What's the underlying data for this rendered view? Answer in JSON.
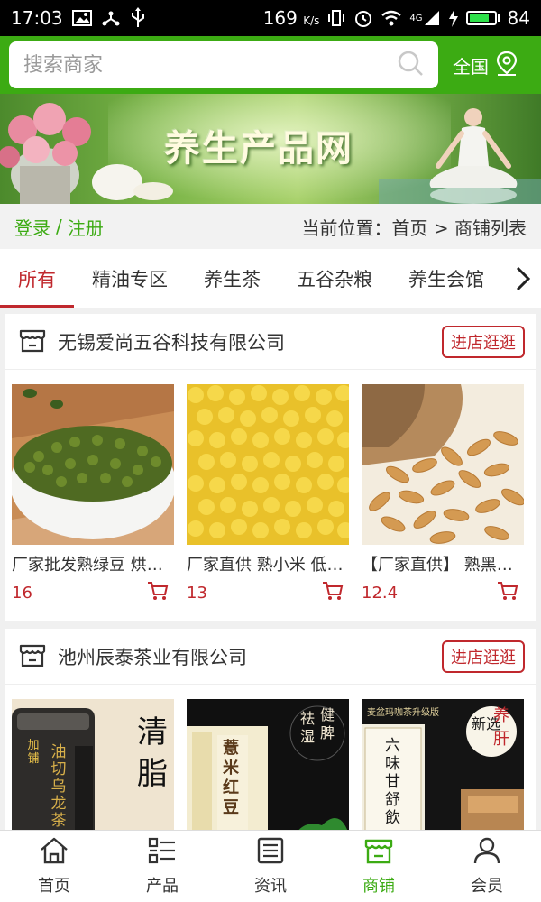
{
  "status_bar": {
    "time": "17:03",
    "speed": "169",
    "speed_unit": "K/s",
    "network": "4G",
    "battery": "84",
    "battery_level": 0.84
  },
  "search": {
    "placeholder": "搜索商家",
    "region": "全国"
  },
  "banner": {
    "title": "养生产品网"
  },
  "nav": {
    "login": "登录",
    "separator": "/",
    "register": "注册",
    "location": "当前位置：首页 > 商铺列表"
  },
  "tabs": [
    "所有",
    "精油专区",
    "养生茶",
    "五谷杂粮",
    "养生会馆"
  ],
  "shops": [
    {
      "name": "无锡爱尚五谷科技有限公司",
      "enter": "进店逛逛",
      "products": [
        {
          "name": "厂家批发熟绿豆 烘焙用绿豆",
          "price": "16"
        },
        {
          "name": "厂家直供 熟小米 低温烘焙",
          "price": "13"
        },
        {
          "name": "【厂家直供】 熟黑燕麦",
          "price": "12.4"
        }
      ]
    },
    {
      "name": "池州辰泰茶业有限公司",
      "enter": "进店逛逛",
      "products": [
        {
          "name": "加铺 油切乌龙茶 清脂"
        },
        {
          "name": "薏米红豆茶 祛湿健脾"
        },
        {
          "name": "六味甘舒饮 新选养肝"
        }
      ]
    }
  ],
  "product_image_text": {
    "tea1_big": "清脂",
    "tea1_side": "油切乌龙茶",
    "tea1_tag": "加铺",
    "tea2_a": "祛湿",
    "tea2_b": "健脾",
    "tea2_box": "薏米红豆",
    "tea3_a": "新选",
    "tea3_b": "养肝",
    "tea3_box": "六味甘舒飲"
  },
  "bottom_nav": [
    {
      "label": "首页",
      "icon": "home-icon"
    },
    {
      "label": "产品",
      "icon": "list-icon"
    },
    {
      "label": "资讯",
      "icon": "news-icon"
    },
    {
      "label": "商铺",
      "icon": "shop-icon"
    },
    {
      "label": "会员",
      "icon": "user-icon"
    }
  ],
  "colors": {
    "brand_green": "#3cab13",
    "accent_red": "#c0282d"
  }
}
